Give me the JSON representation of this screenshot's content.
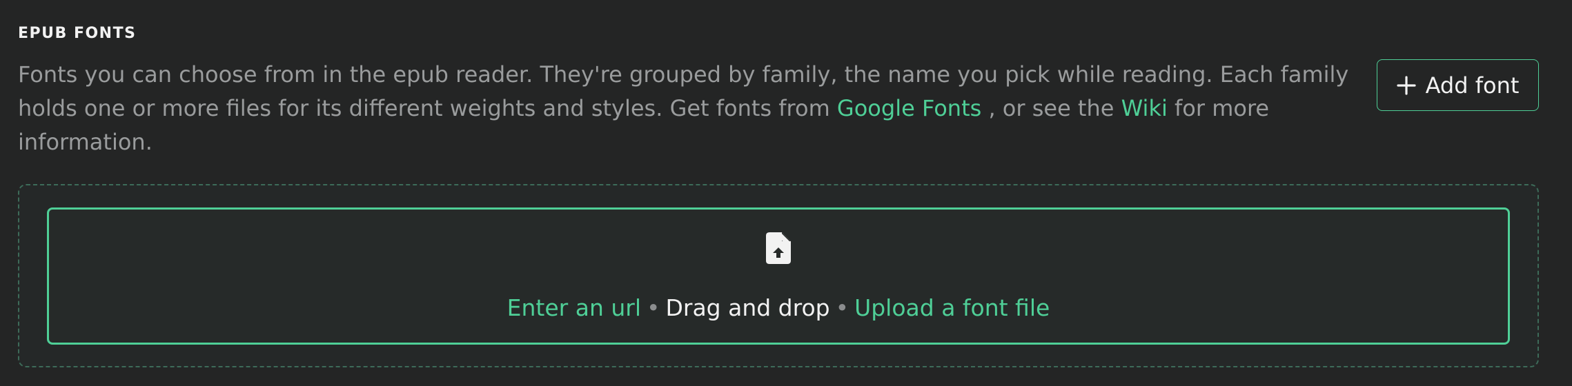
{
  "section": {
    "title": "EPUB FONTS",
    "description": {
      "text_before": "Fonts you can choose from in the epub reader. They're grouped by family, the name you pick while reading. Each family holds one or more files for its different weights and styles. Get fonts from ",
      "google_fonts_link": "Google Fonts",
      "text_middle": " , or see the ",
      "wiki_link": "Wiki",
      "text_after": " for more information."
    },
    "add_font_label": "Add font"
  },
  "dropzone": {
    "icon": "file-upload-icon",
    "enter_url": "Enter an url",
    "separator": "•",
    "drag_drop": "Drag and drop",
    "upload_file": "Upload a font file"
  },
  "colors": {
    "background": "#242525",
    "accent": "#4fcf97",
    "text_muted": "#9a9c9d",
    "text_primary": "#f2f2f2"
  }
}
